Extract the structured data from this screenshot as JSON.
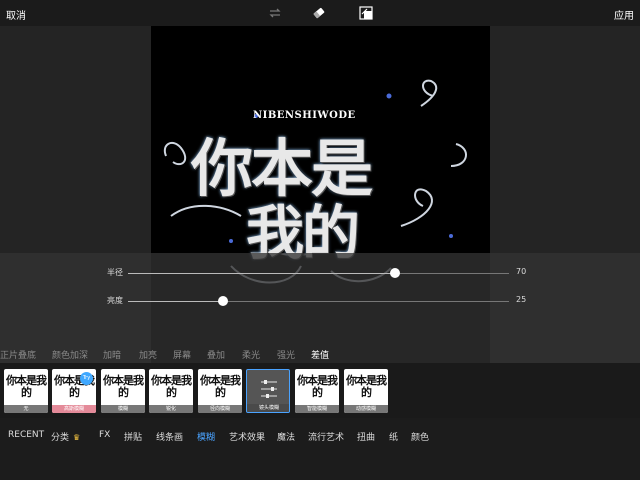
{
  "topbar": {
    "cancel_label": "取消",
    "apply_label": "应用"
  },
  "artwork": {
    "subtitle": "NIBENSHIWODE",
    "line1": "你本是",
    "line2": "我的"
  },
  "sliders": [
    {
      "label": "半径",
      "value": "70",
      "fraction": 0.7
    },
    {
      "label": "亮度",
      "value": "25",
      "fraction": 0.25
    }
  ],
  "blend_modes": [
    "正片叠底",
    "颜色加深",
    "加暗",
    "加亮",
    "屏幕",
    "叠加",
    "柔光",
    "强光",
    "差值"
  ],
  "blend_selected": "差值",
  "thumbnails": [
    {
      "caption": "无",
      "text": "你本是我的"
    },
    {
      "caption": "高斯模糊",
      "text": "你本是我的",
      "badge": "Try"
    },
    {
      "caption": "模糊",
      "text": "你本是我的"
    },
    {
      "caption": "锐化",
      "text": "你本是我的"
    },
    {
      "caption": "径向模糊",
      "text": "你本是我的"
    },
    {
      "caption": "镜头模糊",
      "text": ""
    },
    {
      "caption": "智能模糊",
      "text": "你本是我的"
    },
    {
      "caption": "动感模糊",
      "text": "你本是我的"
    }
  ],
  "categories": [
    "RECENT",
    "分类",
    "FX",
    "拼贴",
    "线条画",
    "模糊",
    "艺术效果",
    "魔法",
    "流行艺术",
    "扭曲",
    "纸",
    "颜色"
  ],
  "category_selected": "模糊",
  "colors": {
    "accent": "#4aa3ff",
    "badge": "#3fa8ff",
    "pink": "#e48a99",
    "crown": "#f5c542"
  }
}
